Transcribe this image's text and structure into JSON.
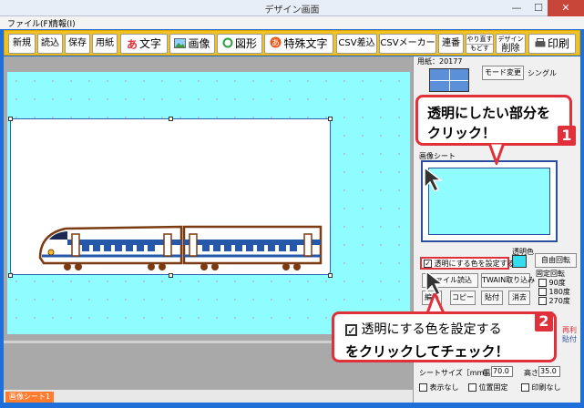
{
  "window": {
    "title": "デザイン画面",
    "controls": {
      "minimize": "—",
      "maximize": "☐",
      "close": "✕"
    }
  },
  "menu": [
    "ファイル(F)",
    "情報(I)"
  ],
  "toolbar": {
    "items": [
      {
        "label": "新規"
      },
      {
        "label": "読込"
      },
      {
        "label": "保存"
      },
      {
        "label": "用紙"
      },
      {
        "label": "文字",
        "icon": "あ"
      },
      {
        "label": "画像"
      },
      {
        "label": "図形"
      },
      {
        "label": "特殊文字"
      },
      {
        "label": "CSV差込"
      },
      {
        "label": "CSVメーカー"
      },
      {
        "label": "連番"
      },
      {
        "label_top": "やり直す",
        "label_bottom": "もどす"
      },
      {
        "label_top": "デザイン",
        "label_bottom": "削除"
      },
      {
        "label": "印刷"
      }
    ]
  },
  "panel": {
    "paper": "用紙：20177",
    "mode_button": "モード変更",
    "mode_value": "シングル",
    "image_sheet_label": "画像シート",
    "transparent_color_label": "透明色",
    "free_rotate": "自由回転",
    "fixed_rotate": "固定回転",
    "rotations": [
      "90度",
      "180度",
      "270度"
    ],
    "transparent_checkbox": "透明にする色を設定する",
    "file_load": "ファイル読込",
    "twain": "TWAIN取り込み",
    "edit": "編集",
    "copy": "コピー",
    "paste": "貼付",
    "delete": "消去",
    "sheet_size_label": "シートサイズ［mm］",
    "width_label": "幅",
    "width_value": "70.0",
    "height_label": "高さ",
    "height_value": "35.0",
    "hide": "表示なし",
    "pos_fixed": "位置固定",
    "no_print": "印刷なし",
    "partial_right": [
      "再利",
      "貼付"
    ]
  },
  "callouts": [
    {
      "number": "1",
      "line1": "透明にしたい部分を",
      "line2": "クリック！"
    },
    {
      "number": "2",
      "check_text": "透明にする色を設定する",
      "line2": "をクリックしてチェック！"
    }
  ],
  "status": {
    "sheet_tab": "画像シート1"
  },
  "colors": {
    "toolbar": "#f4c21f",
    "sheet": "#8ffcff",
    "callout_red": "#e0303a",
    "badge_red": "#e0303a"
  }
}
